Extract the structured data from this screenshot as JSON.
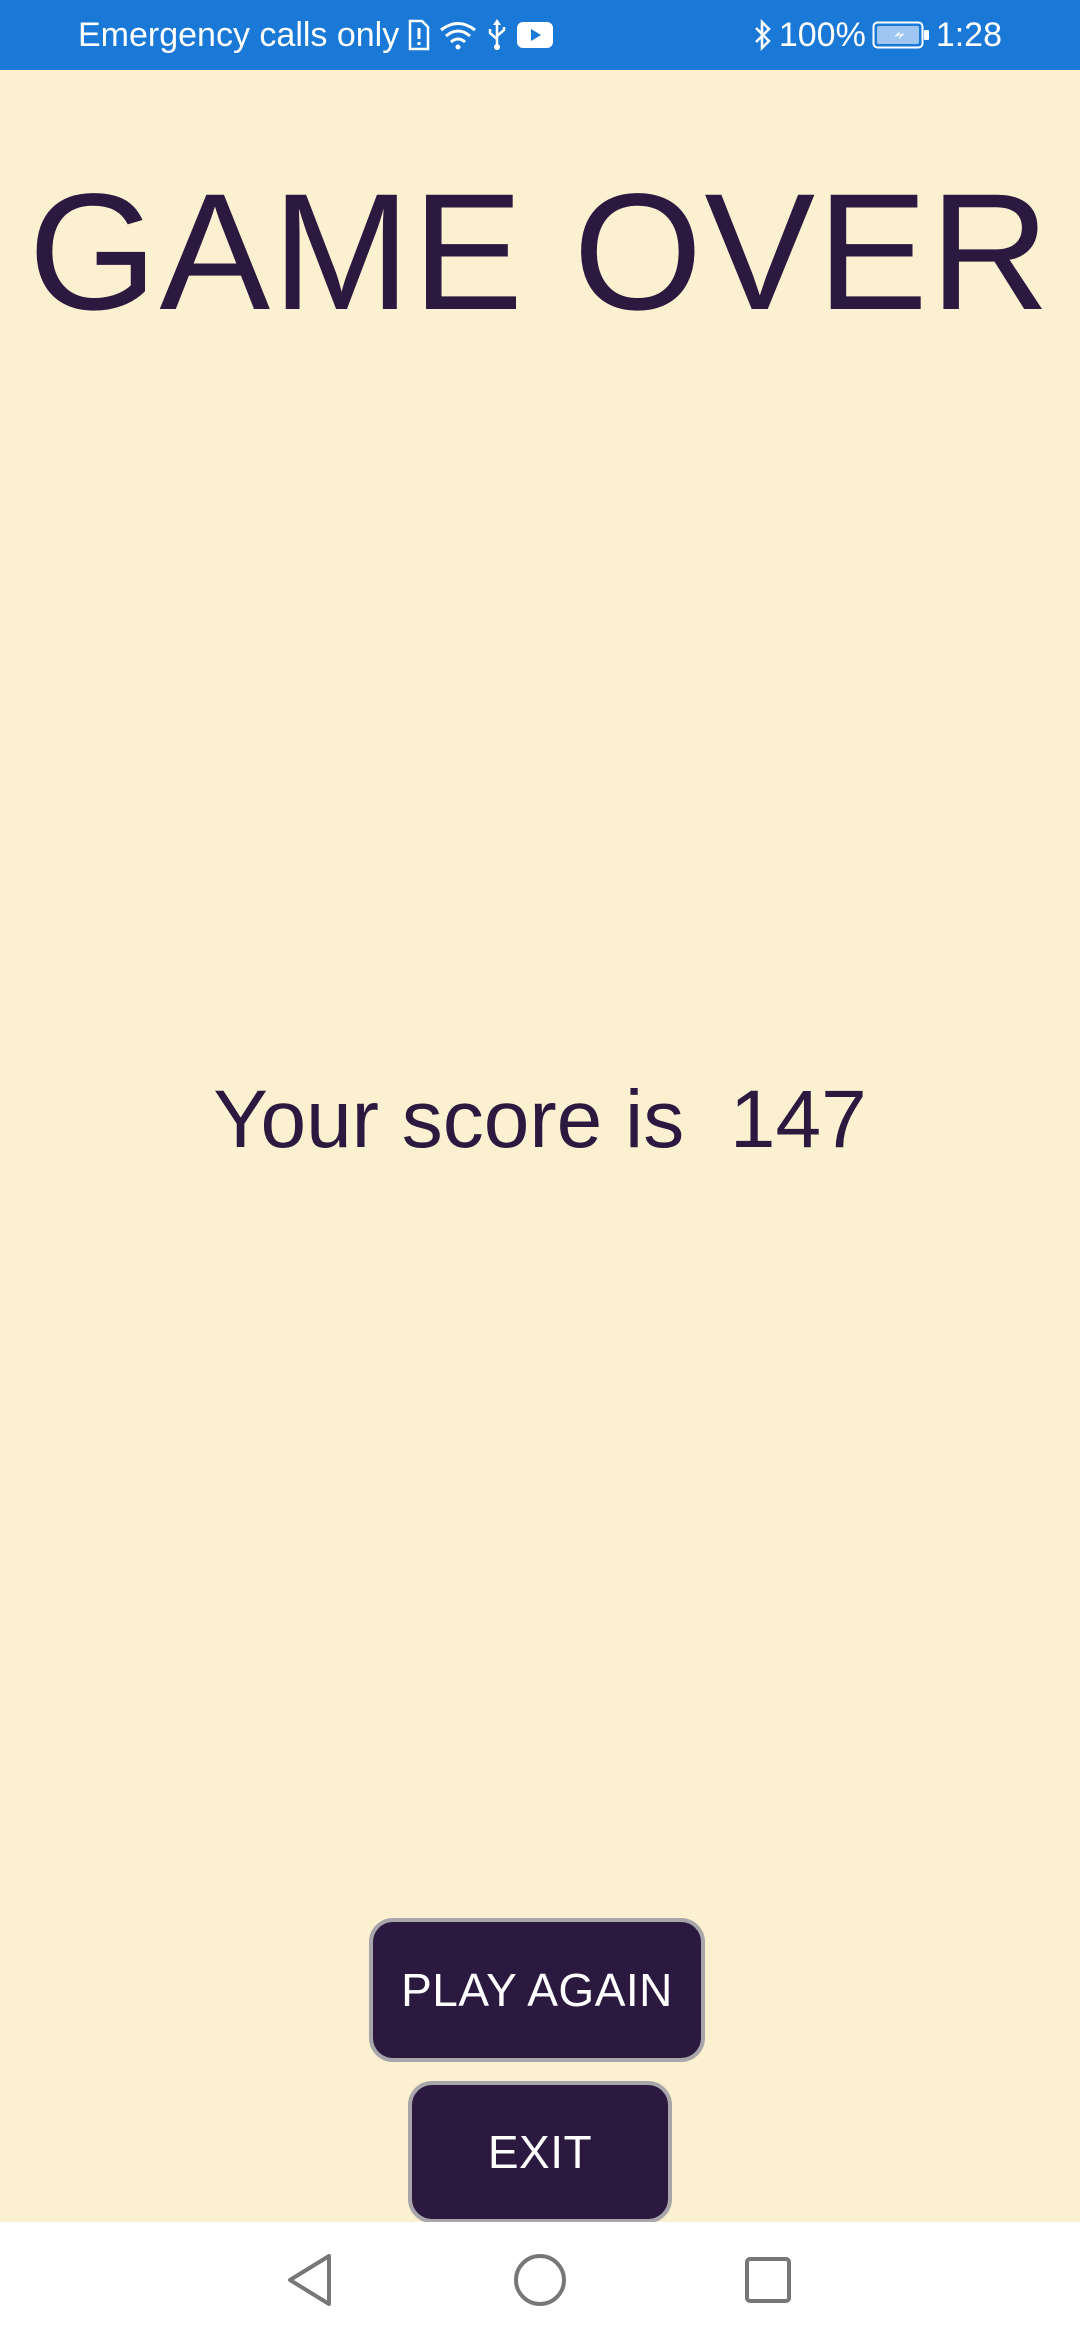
{
  "status_bar": {
    "carrier_text": "Emergency calls only",
    "battery": "100%",
    "time": "1:28",
    "color": "#1a78d6",
    "icons": [
      "sim-alert-icon",
      "wifi-icon",
      "usb-icon",
      "youtube-icon",
      "bluetooth-icon",
      "battery-charging-icon"
    ]
  },
  "game_over": {
    "title": "GAME OVER",
    "score_label": "Your score is ",
    "score_value": "147"
  },
  "buttons": {
    "play_again": "PLAY AGAIN",
    "exit": "EXIT"
  },
  "nav_bar": {
    "icons": [
      "back-icon",
      "home-icon",
      "recent-apps-icon"
    ]
  },
  "colors": {
    "background": "#fbf1d1",
    "text": "#2c1940",
    "button": "#2c1940",
    "button_border": "#a9a6ab"
  }
}
